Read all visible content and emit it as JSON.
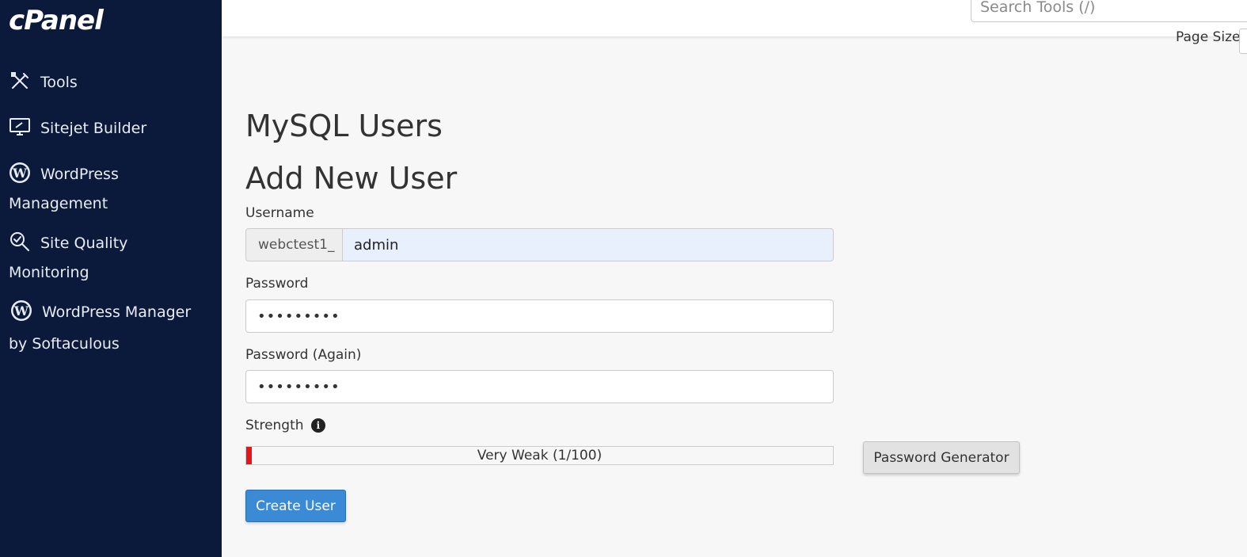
{
  "app": {
    "logo": "cPanel"
  },
  "sidebar": {
    "items": [
      {
        "label": "Tools",
        "icon": "tools-icon"
      },
      {
        "label": "Sitejet Builder",
        "icon": "monitor-edit-icon"
      },
      {
        "label_line1": "WordPress",
        "label_line2": "Management",
        "icon": "wordpress-icon"
      },
      {
        "label_line1": "Site Quality",
        "label_line2": "Monitoring",
        "icon": "magnifier-check-icon"
      },
      {
        "label_line1": "WordPress Manager",
        "label_line2": "by Softaculous",
        "icon": "wordpress-icon"
      }
    ]
  },
  "topbar": {
    "search_placeholder": "Search Tools (/)",
    "page_size_label": "Page Size"
  },
  "main": {
    "page_title": "MySQL Users",
    "section_title": "Add New User",
    "username": {
      "label": "Username",
      "prefix": "webctest1_",
      "value": "admin"
    },
    "password": {
      "label": "Password",
      "value": "•••••••••"
    },
    "password_again": {
      "label": "Password (Again)",
      "value": "•••••••••"
    },
    "strength": {
      "label": "Strength",
      "text": "Very Weak (1/100)",
      "score": 1,
      "max": 100
    },
    "password_generator_label": "Password Generator",
    "create_user_label": "Create User"
  },
  "colors": {
    "sidebar_bg": "#0b1a3b",
    "primary_button": "#3a8ad6",
    "strength_fill": "#e8141a",
    "autofill_bg": "#e8f0fe"
  }
}
